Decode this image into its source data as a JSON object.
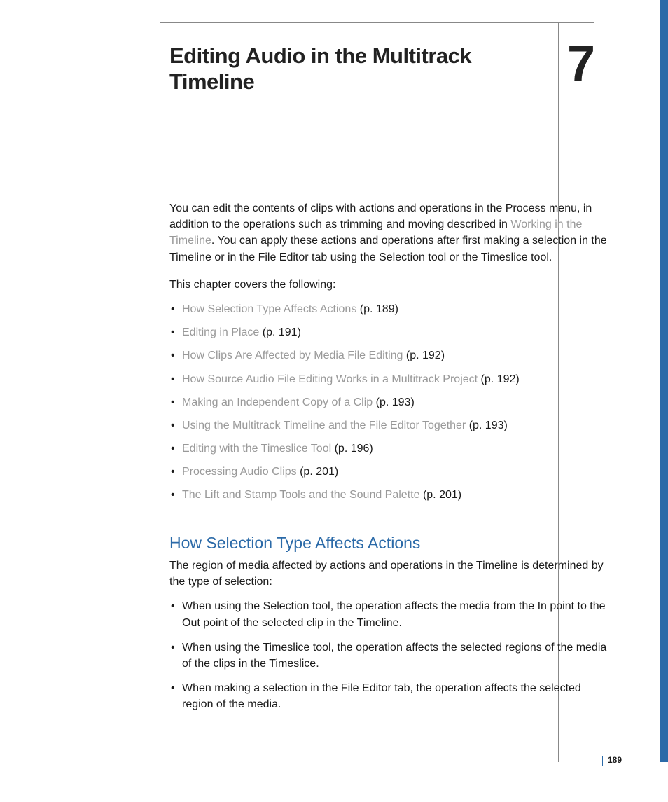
{
  "chapter": {
    "number": "7",
    "title": "Editing Audio in the Multitrack Timeline"
  },
  "intro": {
    "part1": "You can edit the contents of clips with actions and operations in the Process menu, in addition to the operations such as trimming and moving described in ",
    "link": "Working in the Timeline",
    "part2": ". You can apply these actions and operations after first making a selection in the Timeline or in the File Editor tab using the Selection tool or the Timeslice tool."
  },
  "covers_heading": "This chapter covers the following:",
  "toc": [
    {
      "title": "How Selection Type Affects Actions",
      "page": "(p. 189)"
    },
    {
      "title": "Editing in Place",
      "page": "(p. 191)"
    },
    {
      "title": "How Clips Are Affected by Media File Editing",
      "page": "(p. 192)"
    },
    {
      "title": "How Source Audio File Editing Works in a Multitrack Project",
      "page": "(p. 192)"
    },
    {
      "title": "Making an Independent Copy of a Clip",
      "page": "(p. 193)"
    },
    {
      "title": "Using the Multitrack Timeline and the File Editor Together",
      "page": "(p. 193)"
    },
    {
      "title": "Editing with the Timeslice Tool",
      "page": "(p. 196)"
    },
    {
      "title": "Processing Audio Clips",
      "page": "(p. 201)"
    },
    {
      "title": "The Lift and Stamp Tools and the Sound Palette",
      "page": "(p. 201)"
    }
  ],
  "section": {
    "heading": "How Selection Type Affects Actions",
    "para": "The region of media affected by actions and operations in the Timeline is determined by the type of selection:",
    "bullets": [
      "When using the Selection tool, the operation affects the media from the In point to the Out point of the selected clip in the Timeline.",
      "When using the Timeslice tool, the operation affects the selected regions of the media of the clips in the Timeslice.",
      "When making a selection in the File Editor tab, the operation affects the selected region of the media."
    ]
  },
  "page_number": "189"
}
